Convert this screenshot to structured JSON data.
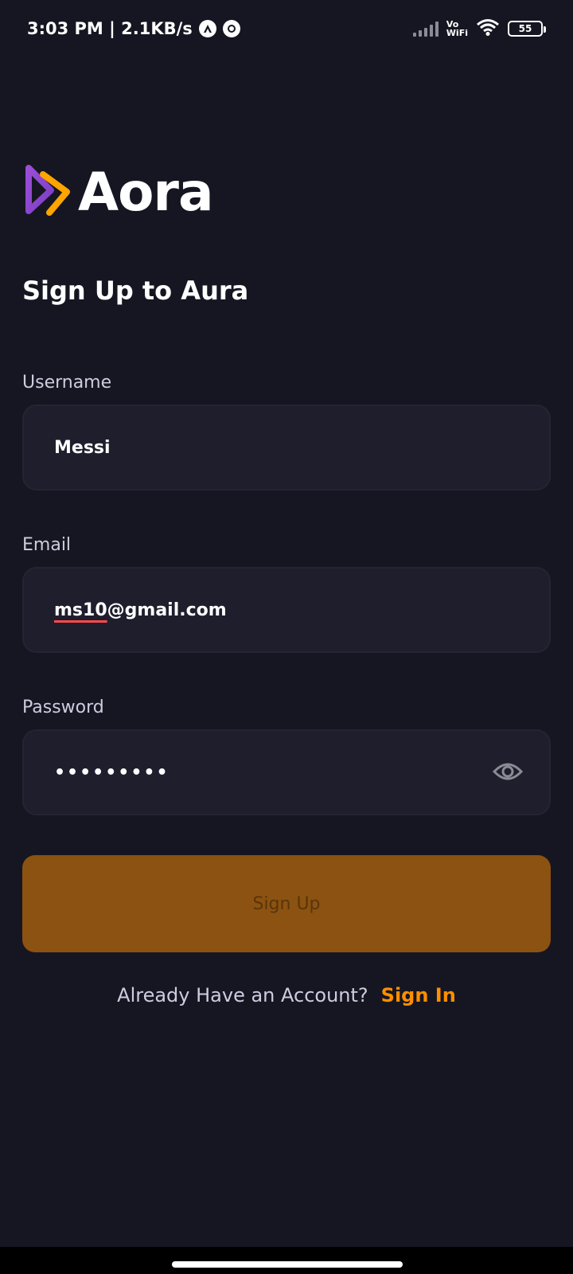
{
  "status_bar": {
    "time_speed": "3:03 PM | 2.1KB/s",
    "vo": "Vo",
    "wifi_text": "WiFi",
    "battery": "55"
  },
  "logo": {
    "text": "Aora"
  },
  "title": "Sign Up to Aura",
  "form": {
    "username": {
      "label": "Username",
      "value": "Messi"
    },
    "email": {
      "label": "Email",
      "value_misspelled": "ms10",
      "value_rest": "@gmail.com"
    },
    "password": {
      "label": "Password",
      "value": "•••••••••"
    }
  },
  "signup_button": "Sign Up",
  "footer": {
    "prompt": "Already Have an Account?",
    "link": "Sign In"
  },
  "colors": {
    "background": "#161622",
    "field": "#1e1e2d",
    "button": "#8c5211",
    "accent": "#ff8e01"
  }
}
